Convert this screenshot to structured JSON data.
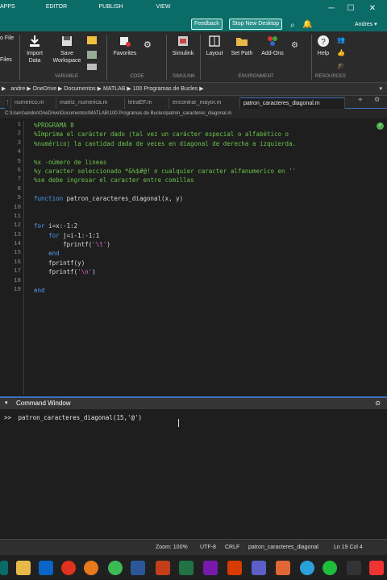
{
  "window": {
    "apps_label": "APPS",
    "editor_label": "EDITOR",
    "publish_label": "PUBLISH",
    "view_label": "VIEW",
    "feedback_label": "Feedback",
    "stop_label": "Stop New Desktop",
    "user_label": "Andres"
  },
  "ribbon": {
    "new_file_label": "o File",
    "files_label": "Files",
    "import_label": "Import Data",
    "save_label": "Save Workspace",
    "favorites_label": "Favorites",
    "simulink_label": "Simulink",
    "layout_label": "Layout",
    "setpath_label": "Set Path",
    "addons_label": "Add-Ons",
    "help_label": "Help",
    "sections": {
      "variable": "VARIABLE",
      "code": "CODE",
      "simulink": "SIMULINK",
      "environment": "ENVIRONMENT",
      "resources": "RESOURCES"
    }
  },
  "breadcrumb": {
    "items": [
      "andre",
      "OneDrive",
      "Documentos",
      "MATLAB",
      "100 Programas de Bucles"
    ]
  },
  "tabs": [
    "numerico.m",
    "matriz_numerica.m",
    "letraEF.m",
    "encontrar_mayor.m",
    "patron_caracteres_diagonal.m"
  ],
  "filepath": "C:\\Users\\andre\\OneDrive\\Documentos\\MATLAB\\100 Programas de Bucles\\patron_caracteres_diagonal.m",
  "code": {
    "line_numbers": [
      "1",
      "2",
      "3",
      "4",
      "5",
      "6",
      "7",
      "8",
      "9",
      "10",
      "11",
      "12",
      "13",
      "14",
      "15",
      "16",
      "17",
      "18",
      "19"
    ],
    "lines": [
      "%PROGRAMA 8",
      "%Imprima el carácter dado (tal vez un carácter especial o alfabético o",
      "%numérico) la cantidad dada de veces en diagonal de derecha a izquierda.",
      "",
      "%x -número de lineas",
      "%y caracter seleccionado *&%$#@! o cualquier caracter alfanumerico en ''",
      "%se debe ingresar el caracter entre comillas",
      "",
      "function patron_caracteres_diagonal(x, y)",
      "",
      "",
      "for i=x:-1:2",
      "    for j=i-1:-1:1",
      "        fprintf('\\t')",
      "    end",
      "    fprintf(y)",
      "    fprintf('\\n')",
      "",
      "end"
    ]
  },
  "command_window": {
    "title": "Command Window",
    "prompt": ">>",
    "input": "patron_caracteres_diagonal(15,'@')"
  },
  "statusbar": {
    "zoom": "Zoom: 100%",
    "encoding": "UTF-8",
    "eol": "CRLF",
    "function": "patron_caracteres_diagonal",
    "position": "Ln 19 Col 4"
  },
  "colors": {
    "titlebar": "#0b6b67",
    "comment": "#6bc24b",
    "keyword": "#4f9cf0",
    "string": "#d66ad6",
    "accent": "#3d6fb6"
  }
}
